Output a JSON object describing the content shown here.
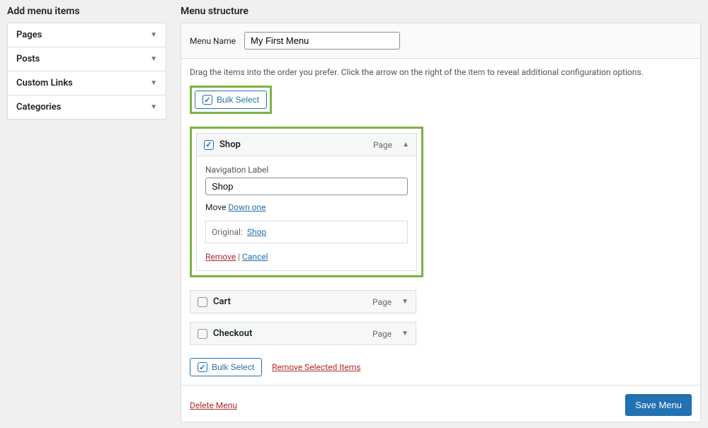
{
  "left": {
    "title": "Add menu items",
    "accordion": [
      {
        "label": "Pages"
      },
      {
        "label": "Posts"
      },
      {
        "label": "Custom Links"
      },
      {
        "label": "Categories"
      }
    ]
  },
  "right": {
    "title": "Menu structure",
    "menu_name_label": "Menu Name",
    "menu_name_value": "My First Menu",
    "instructions": "Drag the items into the order you prefer. Click the arrow on the right of the item to reveal additional configuration options.",
    "bulk_select_label": "Bulk Select",
    "items": [
      {
        "title": "Shop",
        "type": "Page",
        "checked": true,
        "expanded": true,
        "nav_label_text": "Navigation Label",
        "nav_label_value": "Shop",
        "move_label": "Move",
        "move_link": "Down one",
        "original_label": "Original:",
        "original_link": "Shop",
        "remove_label": "Remove",
        "cancel_label": "Cancel"
      },
      {
        "title": "Cart",
        "type": "Page",
        "checked": false,
        "expanded": false
      },
      {
        "title": "Checkout",
        "type": "Page",
        "checked": false,
        "expanded": false
      }
    ],
    "remove_selected_label": "Remove Selected Items",
    "delete_menu_label": "Delete Menu",
    "save_menu_label": "Save Menu"
  }
}
